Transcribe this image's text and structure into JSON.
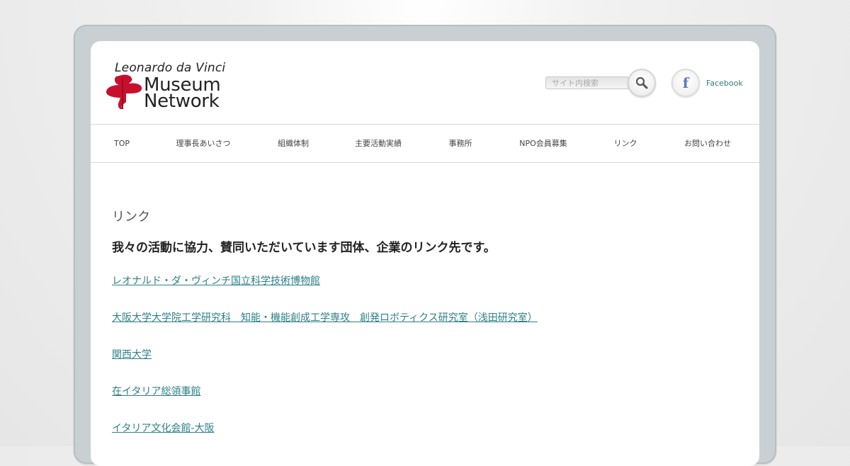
{
  "logo": {
    "line1": "Leonardo da Vinci",
    "line2": "Museum",
    "line3": "Network",
    "icon": "red-gear-emblem"
  },
  "search": {
    "placeholder": "サイト内検索",
    "button_icon": "magnifier-icon"
  },
  "social": {
    "facebook_label": "Facebook",
    "facebook_icon": "f"
  },
  "nav": {
    "items": [
      "TOP",
      "理事長あいさつ",
      "組織体制",
      "主要活動実績",
      "事務所",
      "NPO会員募集",
      "リンク",
      "お問い合わせ"
    ]
  },
  "content": {
    "title": "リンク",
    "intro": "我々の活動に協力、賛同いただいています団体、企業のリンク先です。",
    "links": [
      "レオナルド・ダ・ヴィンチ国立科学技術博物館",
      "大阪大学大学院工学研究科　知能・機能創成工学専攻　創発ロボティクス研究室（浅田研究室）",
      "関西大学",
      "在イタリア総領事館",
      "イタリア文化会館-大阪"
    ]
  },
  "colors": {
    "link": "#2e7f88",
    "logo_red": "#c8102e",
    "frame": "#c9d0d3"
  }
}
